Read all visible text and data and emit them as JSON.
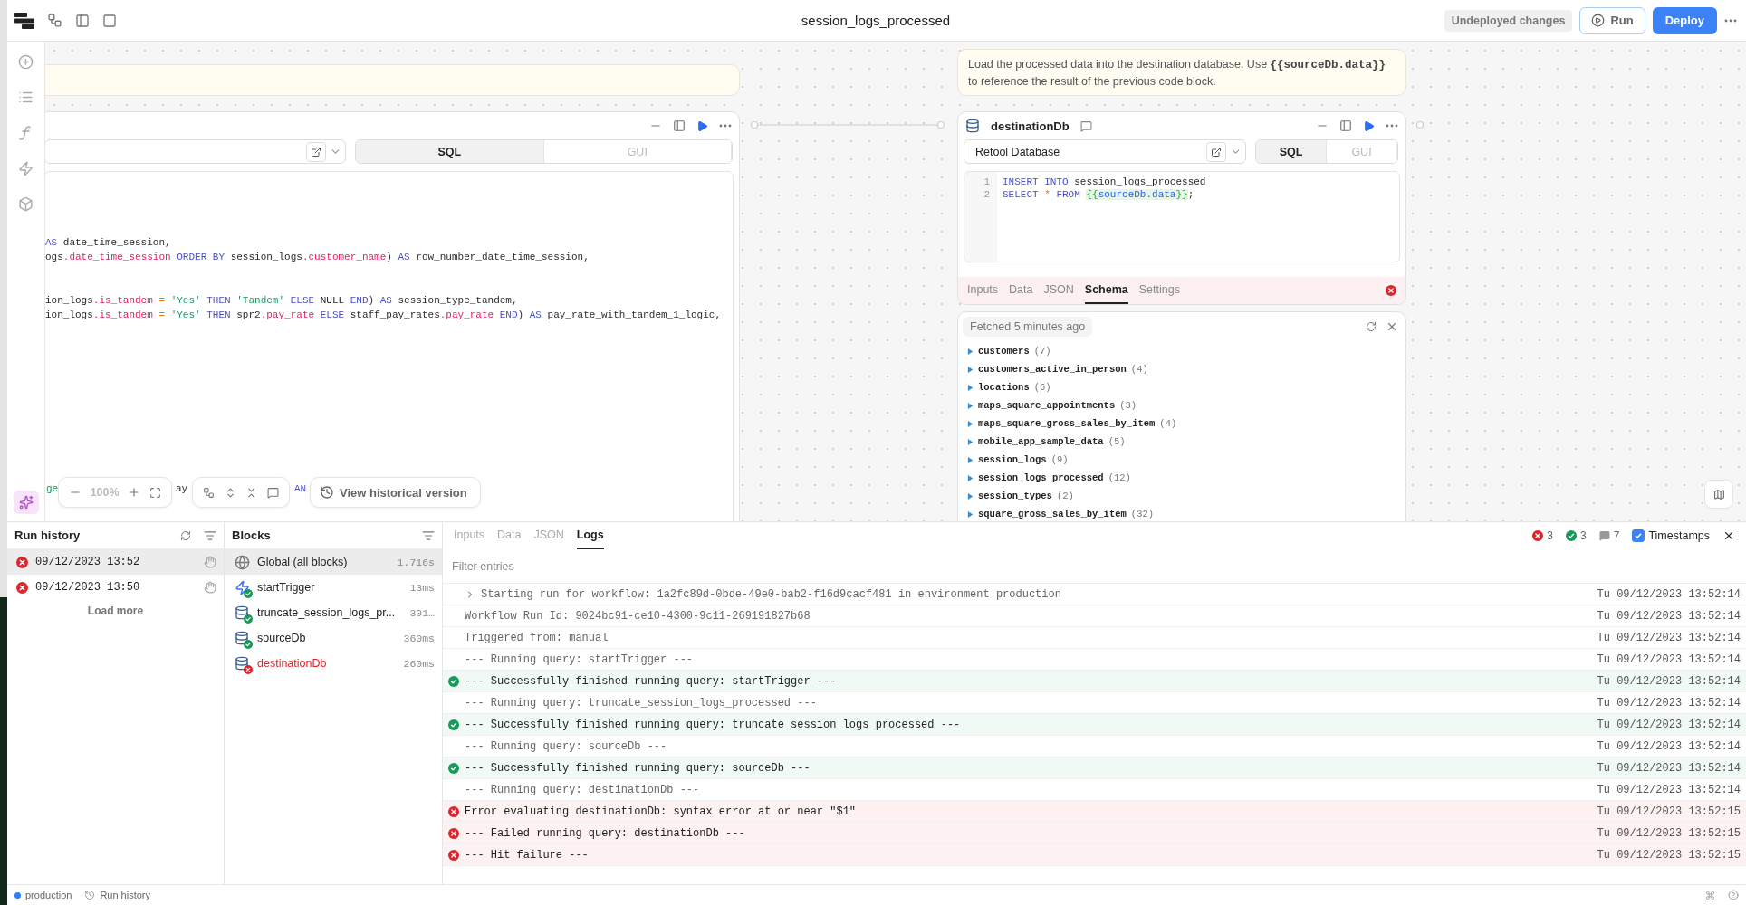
{
  "topbar": {
    "title": "session_logs_processed",
    "status_badge": "Undeployed changes",
    "run_button": "Run",
    "deploy_button": "Deploy"
  },
  "canvas": {
    "source_block": {
      "mode_tabs": [
        {
          "label": "SQL",
          "selected": true
        },
        {
          "label": "GUI",
          "selected": false
        }
      ],
      "code_lines": [
        {
          "tokens": [
            {
              "text": "AS",
              "kind": "kw"
            },
            {
              "text": " date_time_session,",
              "kind": "plain"
            }
          ]
        },
        {
          "tokens": [
            {
              "text": "ogs",
              "kind": "plain"
            },
            {
              "text": ".date_time_session",
              "kind": "prop"
            },
            {
              "text": " ORDER BY",
              "kind": "kw"
            },
            {
              "text": " session_logs",
              "kind": "plain"
            },
            {
              "text": ".customer_name",
              "kind": "prop"
            },
            {
              "text": ") ",
              "kind": "plain"
            },
            {
              "text": "AS",
              "kind": "kw"
            },
            {
              "text": " row_number_date_time_session,",
              "kind": "plain"
            }
          ]
        },
        {
          "tokens": [
            {
              "text": "ion_logs",
              "kind": "plain"
            },
            {
              "text": ".is_tandem",
              "kind": "prop"
            },
            {
              "text": " =",
              "kind": "op"
            },
            {
              "text": " 'Yes'",
              "kind": "str"
            },
            {
              "text": " THEN",
              "kind": "kw"
            },
            {
              "text": " 'Tandem'",
              "kind": "str"
            },
            {
              "text": " ELSE",
              "kind": "kw"
            },
            {
              "text": " NULL ",
              "kind": "plain"
            },
            {
              "text": "END",
              "kind": "kw"
            },
            {
              "text": ") ",
              "kind": "plain"
            },
            {
              "text": "AS",
              "kind": "kw"
            },
            {
              "text": " session_type_tandem,",
              "kind": "plain"
            }
          ]
        },
        {
          "tokens": [
            {
              "text": "ion_logs",
              "kind": "plain"
            },
            {
              "text": ".is_tandem",
              "kind": "prop"
            },
            {
              "text": " =",
              "kind": "op"
            },
            {
              "text": " 'Yes'",
              "kind": "str"
            },
            {
              "text": " THEN",
              "kind": "kw"
            },
            {
              "text": " spr2",
              "kind": "plain"
            },
            {
              "text": ".pay_rate",
              "kind": "prop"
            },
            {
              "text": " ELSE",
              "kind": "kw"
            },
            {
              "text": " staff_pay_rates",
              "kind": "plain"
            },
            {
              "text": ".pay_rate",
              "kind": "prop"
            },
            {
              "text": " END",
              "kind": "kw"
            },
            {
              "text": ") ",
              "kind": "plain"
            },
            {
              "text": "AS",
              "kind": "kw"
            },
            {
              "text": " pay_rate_with_tandem_1_logic,",
              "kind": "plain"
            }
          ]
        }
      ],
      "covered_line": [
        {
          "text": "ge",
          "kind": "str"
        },
        {
          "text": "ay",
          "kind": "plain"
        },
        {
          "text": "AN",
          "kind": "kw"
        }
      ]
    },
    "description_note": {
      "text": "Load the processed data into the destination database. Use **{{sourceDb.data}}** to reference the result of the previous code block."
    },
    "destination_block": {
      "name": "destinationDb",
      "resource": "Retool Database",
      "has_error": true,
      "mode_tabs": [
        {
          "label": "SQL",
          "selected": true
        },
        {
          "label": "GUI",
          "selected": false
        }
      ],
      "code_lines": [
        {
          "number": "1",
          "tokens": [
            {
              "text": "INSERT INTO",
              "kind": "kw"
            },
            {
              "text": " session_logs_processed",
              "kind": "plain"
            }
          ]
        },
        {
          "number": "2",
          "tokens": [
            {
              "text": "SELECT",
              "kind": "kw"
            },
            {
              "text": " *",
              "kind": "op"
            },
            {
              "text": " FROM ",
              "kind": "kw"
            },
            {
              "text": "{{",
              "kind": "brace"
            },
            {
              "text": "sourceDb.data",
              "kind": "ref"
            },
            {
              "text": "}}",
              "kind": "brace"
            },
            {
              "text": ";",
              "kind": "plain"
            }
          ]
        }
      ],
      "tabs": [
        {
          "label": "Inputs",
          "selected": false
        },
        {
          "label": "Data",
          "selected": false
        },
        {
          "label": "JSON",
          "selected": false
        },
        {
          "label": "Schema",
          "selected": true
        },
        {
          "label": "Settings",
          "selected": false
        }
      ]
    },
    "schema": {
      "fetched": "Fetched 5 minutes ago",
      "tables": [
        {
          "name": "customers",
          "count": "(7)",
          "expanded": false
        },
        {
          "name": "customers_active_in_person",
          "count": "(4)",
          "expanded": false
        },
        {
          "name": "locations",
          "count": "(6)",
          "expanded": false
        },
        {
          "name": "maps_square_appointments",
          "count": "(3)",
          "expanded": false
        },
        {
          "name": "maps_square_gross_sales_by_item",
          "count": "(4)",
          "expanded": false
        },
        {
          "name": "mobile_app_sample_data",
          "count": "(5)",
          "expanded": false
        },
        {
          "name": "session_logs",
          "count": "(9)",
          "expanded": false
        },
        {
          "name": "session_logs_processed",
          "count": "(12)",
          "expanded": false
        },
        {
          "name": "session_types",
          "count": "(2)",
          "expanded": false
        },
        {
          "name": "square_gross_sales_by_item",
          "count": "(32)",
          "expanded": false
        }
      ]
    },
    "zoom_level": "100%",
    "history_button": "View historical version"
  },
  "run_history": {
    "title": "Run history",
    "runs": [
      {
        "time": "09/12/2023 13:52",
        "failed": true,
        "selected": true
      },
      {
        "time": "09/12/2023 13:50",
        "failed": true,
        "selected": false
      }
    ],
    "load_more": "Load more"
  },
  "blocks": {
    "title": "Blocks",
    "items": [
      {
        "kind": "global",
        "name": "Global (all blocks)",
        "duration": "1.716s",
        "succeeded": false,
        "failed": false,
        "selected": true
      },
      {
        "kind": "trigger",
        "name": "startTrigger",
        "duration": "13ms",
        "succeeded": true,
        "failed": false,
        "selected": false
      },
      {
        "kind": "database",
        "name": "truncate_session_logs_pr...",
        "duration": "301…",
        "succeeded": true,
        "failed": false,
        "selected": false
      },
      {
        "kind": "database",
        "name": "sourceDb",
        "duration": "360ms",
        "succeeded": true,
        "failed": false,
        "selected": false
      },
      {
        "kind": "database",
        "name": "destinationDb",
        "duration": "260ms",
        "succeeded": false,
        "failed": true,
        "selected": false
      }
    ]
  },
  "logs": {
    "tabs": [
      {
        "label": "Inputs",
        "selected": false
      },
      {
        "label": "Data",
        "selected": false
      },
      {
        "label": "JSON",
        "selected": false
      },
      {
        "label": "Logs",
        "selected": true
      }
    ],
    "error_count": "3",
    "success_count": "3",
    "message_count": "7",
    "timestamps": {
      "label": "Timestamps",
      "checked": true
    },
    "filter_placeholder": "Filter entries",
    "entries": [
      {
        "kind": "info",
        "expandable": true,
        "text": "Starting run for workflow: 1a2fc89d-0bde-49e0-bab2-f16d9cacf481 in environment production",
        "time": "Tu 09/12/2023 13:52:14"
      },
      {
        "kind": "info",
        "expandable": false,
        "text": "Workflow Run Id: 9024bc91-ce10-4300-9c11-269191827b68",
        "time": "Tu 09/12/2023 13:52:14"
      },
      {
        "kind": "info",
        "expandable": false,
        "text": "Triggered from: manual",
        "time": "Tu 09/12/2023 13:52:14"
      },
      {
        "kind": "info",
        "expandable": false,
        "text": "--- Running query: startTrigger ---",
        "time": "Tu 09/12/2023 13:52:14"
      },
      {
        "kind": "success",
        "expandable": false,
        "text": "--- Successfully finished running query: startTrigger ---",
        "time": "Tu 09/12/2023 13:52:14"
      },
      {
        "kind": "info",
        "expandable": false,
        "text": "--- Running query: truncate_session_logs_processed ---",
        "time": "Tu 09/12/2023 13:52:14"
      },
      {
        "kind": "success",
        "expandable": false,
        "text": "--- Successfully finished running query: truncate_session_logs_processed ---",
        "time": "Tu 09/12/2023 13:52:14"
      },
      {
        "kind": "info",
        "expandable": false,
        "text": "--- Running query: sourceDb ---",
        "time": "Tu 09/12/2023 13:52:14"
      },
      {
        "kind": "success",
        "expandable": false,
        "text": "--- Successfully finished running query: sourceDb ---",
        "time": "Tu 09/12/2023 13:52:14"
      },
      {
        "kind": "info",
        "expandable": false,
        "text": "--- Running query: destinationDb ---",
        "time": "Tu 09/12/2023 13:52:14"
      },
      {
        "kind": "error",
        "expandable": false,
        "text": "Error evaluating destinationDb: syntax error at or near \"$1\"",
        "time": "Tu 09/12/2023 13:52:15"
      },
      {
        "kind": "error",
        "expandable": false,
        "text": "--- Failed running query: destinationDb ---",
        "time": "Tu 09/12/2023 13:52:15"
      },
      {
        "kind": "error",
        "expandable": false,
        "text": "--- Hit failure ---",
        "time": "Tu 09/12/2023 13:52:15"
      }
    ]
  },
  "status_bar": {
    "environment": "production",
    "run_history": "Run history"
  }
}
